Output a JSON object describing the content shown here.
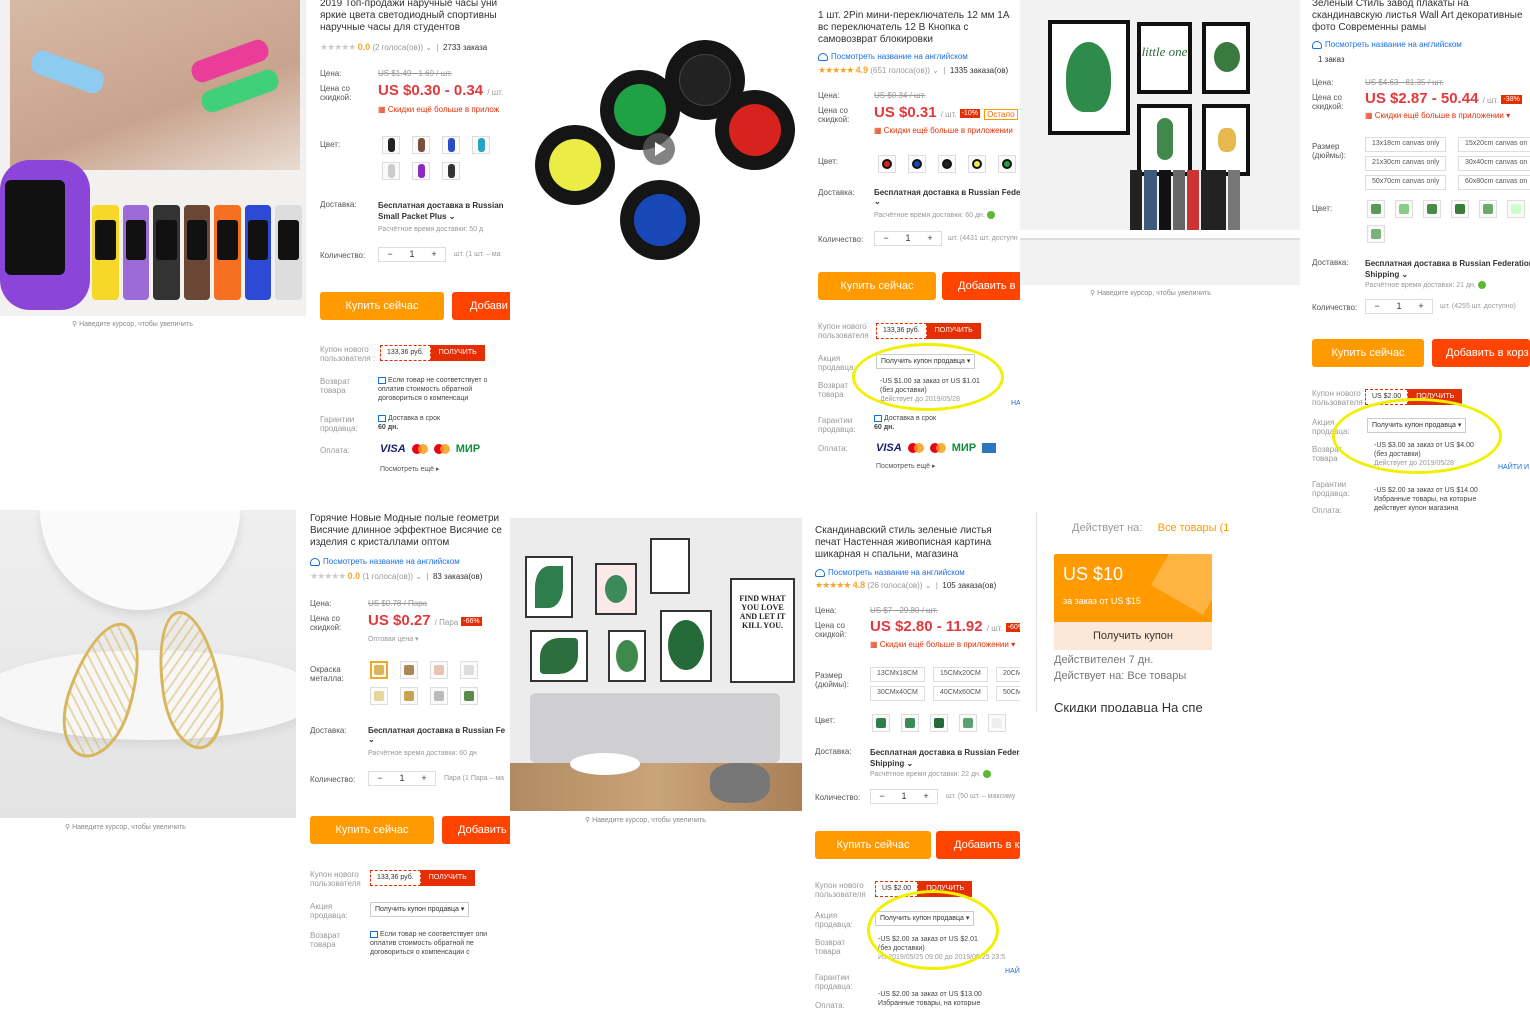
{
  "zoom_hint": "Наведите курсор, чтобы увеличить",
  "p1": {
    "title": "2019 Топ-продажи наручные часы уни яркие цвета светодиодный спортивны наручные часы для студентов",
    "rating": "0.0",
    "votes": "(2 голоса(ов))",
    "orders": "2733 заказа",
    "price_label": "Цена:",
    "old_price": "US $1.49 - 1.69 / шт.",
    "disc_label": "Цена со скидкой:",
    "price": "US $0.30 - 0.34",
    "unit": "/ шт.",
    "app_discount": "Скидки ещё больше в прилож",
    "color_label": "Цвет:",
    "ship_label": "Доставка:",
    "ship_value": "Бесплатная доставка в Russian",
    "ship_value2": "Small Packet Plus",
    "ship_time": "Расчётное время доставки: 50 д",
    "qty_label": "Количество:",
    "qty": "1",
    "qty_note": "шт. (1 шт. – ма",
    "buy": "Купить сейчас",
    "add": "Добави",
    "coupon_label": "Купон нового пользователя :",
    "coupon_value": "133,36 руб.",
    "coupon_get": "ПОЛУЧИТЬ",
    "return_label": "Возврат товара",
    "return_text": "Если товар не соответствует о оплатив стоимость обратной договориться о компенсаци",
    "guarantee_label": "Гарантии продавца:",
    "guarantee_text": "Доставка в срок",
    "guarantee_days": "60 дн.",
    "pay_label": "Оплата:",
    "pay_visa": "VISA",
    "pay_mir": "МИР",
    "more": "Посмотреть ещё"
  },
  "p2": {
    "title": "1 шт. 2Pin мини-переключатель 12 мм 1А вс переключатель 12 В Кнопка с самовозврат блокировки",
    "en_link": "Посмотреть название на английском",
    "rating": "4.9",
    "votes": "(651 голоса(ов))",
    "orders": "1335 заказа(ов)",
    "price_label": "Цена:",
    "old_price": "US $0.34 / шт.",
    "disc_label": "Цена со скидкой:",
    "price": "US $0.31",
    "unit": "/ шт.",
    "badge": "-10%",
    "stock": "Остало",
    "app_discount": "Скидки ещё больше в приложении",
    "color_label": "Цвет:",
    "ship_label": "Доставка:",
    "ship_value": "Бесплатная доставка в Russian Feder",
    "ship_time": "Расчётное время доставки: 60 дн.",
    "qty_label": "Количество:",
    "qty": "1",
    "qty_note": "шт. (4431 шт. доступн",
    "buy": "Купить сейчас",
    "add": "Добавить в",
    "coupon_label": "Купон нового пользователя",
    "coupon_value": "133,36 руб.",
    "coupon_get": "ПОЛУЧИТЬ",
    "promo_label": "Акция продавца:",
    "promo_dd": "Получить купон продавца",
    "promo_text": "-US $1.00 за заказ от US $1.01",
    "promo_text2": "(без доставки)",
    "promo_valid": "Действует до 2019/05/28",
    "find": "НА",
    "return_label": "Возврат товара",
    "guarantee_label": "Гарантии продавца:",
    "guarantee_text": "Доставка в срок",
    "guarantee_days": "60 дн.",
    "pay_label": "Оплата:",
    "pay_visa": "VISA",
    "pay_mir": "МИР",
    "more": "Посмотреть ещё"
  },
  "p3": {
    "title": "Зеленый Стиль завод плакаты на скандинавскую листья Wall Art декоративные фото Современны рамы",
    "en_link": "Посмотреть название на английском",
    "orders": "1 заказ",
    "price_label": "Цена:",
    "old_price": "US $4.63 - 81.35 / шт.",
    "disc_label": "Цена со скидкой:",
    "price": "US $2.87 - 50.44",
    "unit": "/ шт.",
    "badge": "-38%",
    "app_discount": "Скидки ещё больше в приложении",
    "size_label": "Размер (дюймы):",
    "sizes": [
      "13x18cm canvas only",
      "15x20cm canvas on",
      "21x30cm canvas only",
      "30x40cm canvas on",
      "50x70cm canvas only",
      "60x80cm canvas on"
    ],
    "color_label": "Цвет:",
    "ship_label": "Доставка:",
    "ship_value": "Бесплатная доставка в Russian Federation o",
    "ship_value2": "Shipping",
    "ship_time": "Расчётное время доставки: 21 дн.",
    "qty_label": "Количество:",
    "qty": "1",
    "qty_note": "шт. (4255 шт. доступно)",
    "buy": "Купить сейчас",
    "add": "Добавить в корз",
    "coupon_label": "Купон нового пользователя",
    "coupon_value": "US $2.00",
    "coupon_get": "ПОЛУЧИТЬ",
    "promo_label": "Акция продавца:",
    "promo_dd": "Получить купон продавца",
    "promo_text": "-US $3.00 за заказ от US $4.00",
    "promo_text2": "(без доставки)",
    "promo_valid": "Действует до 2019/05/28",
    "find": "НАЙТИ И",
    "return_label": "Возврат товара",
    "guarantee_label": "Гарантии продавца:",
    "pay_label": "Оплата:",
    "store_text": "-US $2.00 за заказ от US $14.00",
    "store_text2": "Избранные товары, на которые",
    "store_text3": "действует купон магазина"
  },
  "p4": {
    "title": "Горячие Новые Модные полые геометри Висячие длинное эффектное Висячие се изделия с кристаллами оптом",
    "en_link": "Посмотреть название на английском",
    "rating": "0.0",
    "votes": "(1 голоса(ов))",
    "orders": "83 заказа(ов)",
    "price_label": "Цена:",
    "old_price": "US $0.78 / Пара",
    "disc_label": "Цена со скидкой:",
    "price": "US $0.27",
    "unit": "/ Пара",
    "badge": "-66%",
    "wholesale": "Оптовая цена",
    "color_label": "Окраска металла:",
    "ship_label": "Доставка:",
    "ship_value": "Бесплатная доставка в Russian Fe",
    "ship_time": "Расчётное время доставки: 60 дн",
    "qty_label": "Количество:",
    "qty": "1",
    "qty_note": "Пара (1 Пара – ма",
    "buy": "Купить сейчас",
    "add": "Добавить",
    "coupon_label": "Купон нового пользователя",
    "coupon_value": "133,36 руб.",
    "coupon_get": "ПОЛУЧИТЬ",
    "promo_label": "Акция продавца:",
    "promo_dd": "Получить купон продавца",
    "return_label": "Возврат товара",
    "return_text": "Если товар не соответствует опи оплатив стоимость обратной пе договориться о компенсации с"
  },
  "p5": {
    "poster_text": "FIND WHAT YOU LOVE AND LET IT KILL YOU.",
    "title": "Скандинавский стиль зеленые листья печат Настенная живописная картина шикарная н спальни, магазина",
    "en_link": "Посмотреть название на английском",
    "rating": "4.8",
    "votes": "(26 голоса(ов))",
    "orders": "105 заказа(ов)",
    "price_label": "Цена:",
    "old_price": "US $7 - 29.80 / шт.",
    "disc_label": "Цена со скидкой:",
    "price": "US $2.80 - 11.92",
    "unit": "/ шт.",
    "badge": "-60%",
    "app_discount": "Скидки ещё больше в приложении",
    "size_label": "Размер (дюймы):",
    "sizes": [
      "13CMx18CM",
      "15CMx20CM",
      "20CM",
      "30CMx40CM",
      "40CMx60CM",
      "50CM"
    ],
    "color_label": "Цвет:",
    "ship_label": "Доставка:",
    "ship_value": "Бесплатная доставка в Russian Federa",
    "ship_value2": "Shipping",
    "ship_time": "Расчётное время доставки: 22 дн.",
    "qty_label": "Количество:",
    "qty": "1",
    "qty_note": "шт. (50 шт. – максиму",
    "buy": "Купить сейчас",
    "add": "Добавить в к",
    "coupon_label": "Купон нового пользователя",
    "coupon_value": "US $2.00",
    "coupon_get": "ПОЛУЧИТЬ",
    "promo_label": "Акция продавца:",
    "promo_dd": "Получить купон продавца",
    "promo_text": "-US $2.00 за заказ от US $2.01",
    "promo_text2": "(без доставки)",
    "promo_valid": "Из 2019/05/25 09:00 до 2019/05/25 23:5",
    "find": "НАЙ",
    "return_label": "Возврат товара",
    "guarantee_label": "Гарантии продавца:",
    "pay_label": "Оплата:",
    "store_text": "-US $2.00 за заказ от US $13.00",
    "store_text2": "Избранные товары, на которые"
  },
  "p6": {
    "valid_on_label": "Действует на:",
    "valid_on_value": "Все товары (1",
    "amount": "US $10",
    "condition": "за заказ от US $15",
    "get": "Получить купон",
    "validity": "Действителен 7 дн.",
    "applies": "Действует на: Все товары",
    "heading": "Скидки продавца На спе"
  },
  "colors": {
    "accent": "#ff9a00",
    "red": "#e62e04",
    "highlight": "#f1f000"
  }
}
